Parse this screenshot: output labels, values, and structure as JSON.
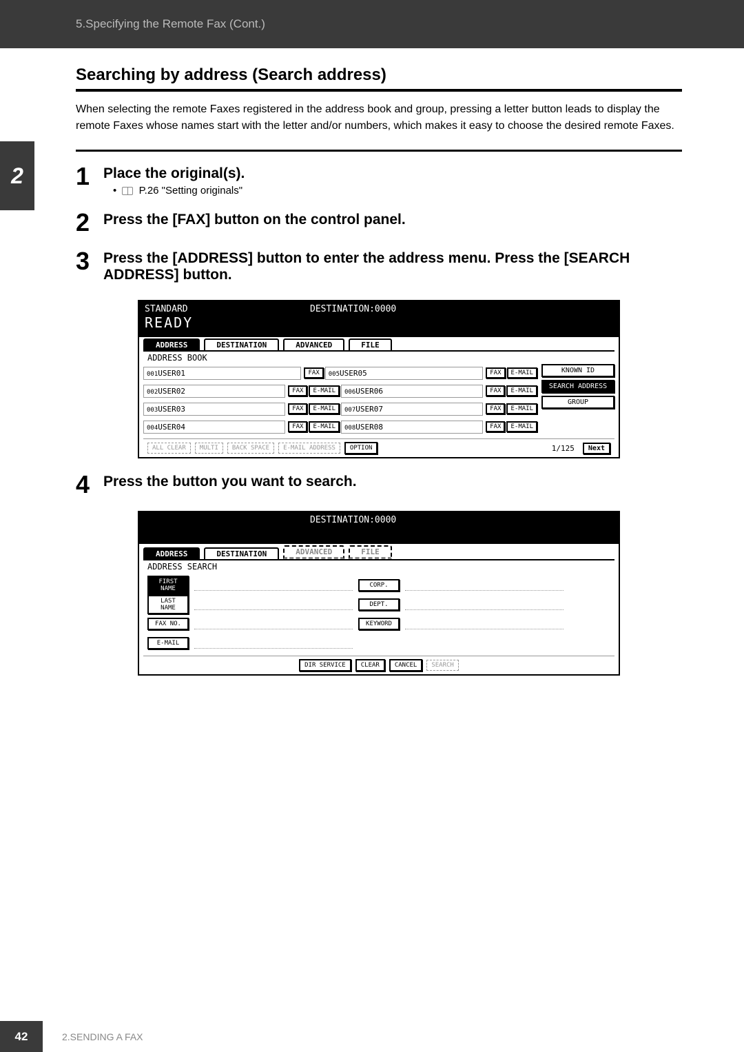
{
  "header": {
    "breadcrumb": "5.Specifying the Remote Fax (Cont.)"
  },
  "sideTab": "2",
  "section": {
    "title": "Searching by address (Search address)",
    "intro": "When selecting the remote Faxes registered in the address book and group, pressing a letter button leads to display the remote Faxes whose names start with the letter and/or numbers, which makes it easy to choose the desired remote Faxes."
  },
  "steps": [
    {
      "num": "1",
      "title": "Place the original(s).",
      "bullet": "P.26 \"Setting originals\""
    },
    {
      "num": "2",
      "title": "Press the [FAX] button on the control panel."
    },
    {
      "num": "3",
      "title": "Press the [ADDRESS] button to enter the address menu. Press the [SEARCH ADDRESS] button."
    },
    {
      "num": "4",
      "title": "Press the button you want to search."
    }
  ],
  "screen1": {
    "status": "STANDARD",
    "dest": "DESTINATION:0000",
    "ready": "READY",
    "tabs": [
      "ADDRESS",
      "DESTINATION",
      "ADVANCED",
      "FILE"
    ],
    "subtitle": "ADDRESS BOOK",
    "entries": [
      {
        "id": "001",
        "name": "USER01",
        "buttons": [
          "FAX"
        ],
        "id2": "005",
        "name2": "USER05",
        "buttons2": [
          "FAX",
          "E-MAIL"
        ]
      },
      {
        "id": "002",
        "name": "USER02",
        "buttons": [
          "FAX",
          "E-MAIL"
        ],
        "id2": "006",
        "name2": "USER06",
        "buttons2": [
          "FAX",
          "E-MAIL"
        ]
      },
      {
        "id": "003",
        "name": "USER03",
        "buttons": [
          "FAX",
          "E-MAIL"
        ],
        "id2": "007",
        "name2": "USER07",
        "buttons2": [
          "FAX",
          "E-MAIL"
        ]
      },
      {
        "id": "004",
        "name": "USER04",
        "buttons": [
          "FAX",
          "E-MAIL"
        ],
        "id2": "008",
        "name2": "USER08",
        "buttons2": [
          "FAX",
          "E-MAIL"
        ]
      }
    ],
    "side": [
      "KNOWN ID",
      "SEARCH ADDRESS",
      "GROUP"
    ],
    "bottom": [
      "ALL CLEAR",
      "MULTI",
      "BACK SPACE",
      "E-MAIL ADDRESS",
      "OPTION"
    ],
    "pageCount": "1/125",
    "next": "Next"
  },
  "screen2": {
    "dest": "DESTINATION:0000",
    "tabs": [
      "ADDRESS",
      "DESTINATION",
      "ADVANCED",
      "FILE"
    ],
    "subtitle": "ADDRESS SEARCH",
    "leftFields": [
      "FIRST NAME",
      "LAST NAME",
      "FAX NO.",
      "E-MAIL"
    ],
    "rightFields": [
      "CORP.",
      "DEPT.",
      "KEYWORD"
    ],
    "bottom": [
      "DIR SERVICE",
      "CLEAR",
      "CANCEL",
      "SEARCH"
    ]
  },
  "footer": {
    "page": "42",
    "chapter": "2.SENDING A FAX"
  }
}
